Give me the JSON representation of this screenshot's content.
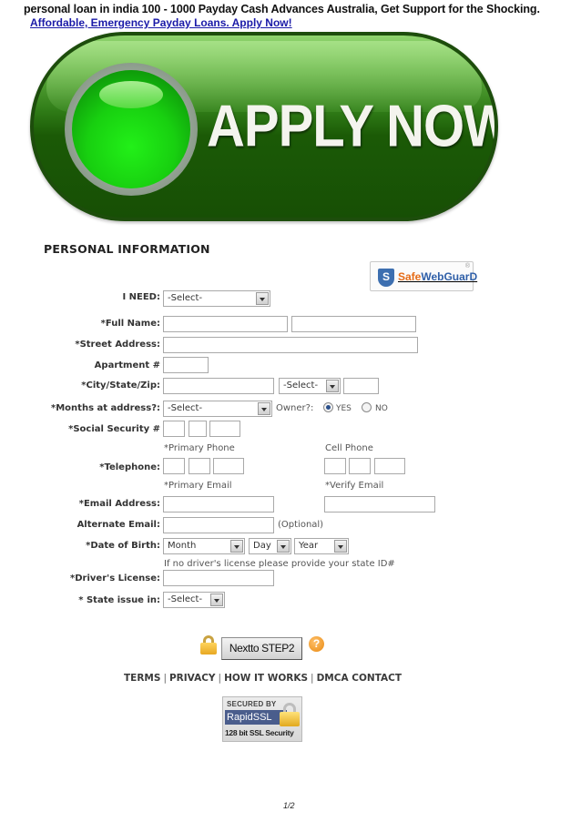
{
  "header": {
    "title": "personal loan in india 100 - 1000 Payday Cash Advances Australia, Get Support for the Shocking.",
    "link": "Affordable, Emergency Payday Loans. Apply Now!"
  },
  "banner": {
    "label": "APPLY NOW",
    "colors": {
      "dark": "#174f05",
      "orb": "#18d010"
    }
  },
  "form": {
    "title": "PERSONAL INFORMATION",
    "seal": {
      "icon": "shield-icon",
      "letter": "S",
      "safe": "Safe",
      "rest": "WebGuarD",
      "reg": "®"
    },
    "fields": {
      "i_need": {
        "label": "I NEED:",
        "value": "-Select-"
      },
      "full_name": {
        "label": "*Full Name:",
        "first": "",
        "last": ""
      },
      "street": {
        "label": "*Street Address:",
        "value": ""
      },
      "apartment": {
        "label": "Apartment #",
        "value": ""
      },
      "city_state_zip": {
        "label": "*City/State/Zip:",
        "city": "",
        "state": "-Select-",
        "zip": ""
      },
      "months": {
        "label": "*Months at address?:",
        "value": "-Select-"
      },
      "owner": {
        "label": "Owner?:",
        "options": [
          "YES",
          "NO"
        ],
        "selected": "YES"
      },
      "ssn": {
        "label": "*Social Security #"
      },
      "telephone": {
        "label": "*Telephone:",
        "primary_hint": "*Primary Phone",
        "cell_hint": "Cell Phone"
      },
      "email": {
        "label": "*Email Address:",
        "primary_hint": "*Primary Email",
        "verify_hint": "*Verify Email",
        "value": "",
        "verify": ""
      },
      "alt_email": {
        "label": "Alternate Email:",
        "value": "",
        "note": "(Optional)"
      },
      "dob": {
        "label": "*Date of Birth:",
        "month": "Month",
        "day": "Day",
        "year": "Year"
      },
      "license": {
        "label": "*Driver's License:",
        "hint": "If no driver's license please provide your state ID#",
        "value": ""
      },
      "state_issue": {
        "label": "* State issue in:",
        "value": "-Select-"
      }
    },
    "next_button": "Nextto STEP2",
    "help": "?"
  },
  "footer": {
    "links": [
      "TERMS",
      "PRIVACY",
      "HOW IT WORKS",
      "DMCA CONTACT"
    ],
    "separator": "|",
    "ssl": {
      "secured": "SECURED BY",
      "brand": "RapidSSL",
      "bits": "128 bit SSL Security"
    }
  },
  "page": "1/2"
}
